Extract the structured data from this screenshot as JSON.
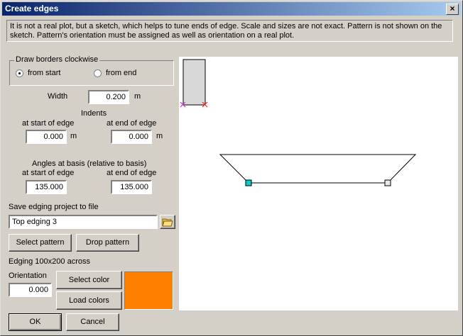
{
  "window": {
    "title": "Create edges",
    "close_glyph": "×"
  },
  "info_text": "It is not a real plot, but a sketch, which helps to tune ends of edge. Scale and sizes are not exact. Pattern is not shown on the sketch. Pattern's orientation must be assigned as well as orientation on a real plot.",
  "draw_borders": {
    "legend": "Draw borders clockwise",
    "from_start": "from start",
    "from_end": "from end",
    "selected": "from start"
  },
  "width": {
    "label": "Width",
    "value": "0.200",
    "unit": "m"
  },
  "indents": {
    "title": "Indents",
    "start_label": "at start of edge",
    "end_label": "at end of edge",
    "start_value": "0.000",
    "end_value": "0.000",
    "unit": "m"
  },
  "angles": {
    "title": "Angles at basis (relative to basis)",
    "start_label": "at start of edge",
    "end_label": "at end of edge",
    "start_value": "135.000",
    "end_value": "135.000"
  },
  "save": {
    "label": "Save edging project to file",
    "value": "Top edging 3"
  },
  "buttons": {
    "select_pattern": "Select pattern",
    "drop_pattern": "Drop pattern",
    "select_color": "Select color",
    "load_colors": "Load colors",
    "ok": "OK",
    "cancel": "Cancel"
  },
  "edging_info": "Edging 100x200 across",
  "orientation": {
    "label": "Orientation",
    "value": "0.000"
  },
  "colors": {
    "swatch": "#ff8000",
    "start_marker": "#cc33cc",
    "end_marker": "#ff2020",
    "start_node": "#00d0d0"
  },
  "icons": {
    "folder": "folder-open-icon"
  }
}
